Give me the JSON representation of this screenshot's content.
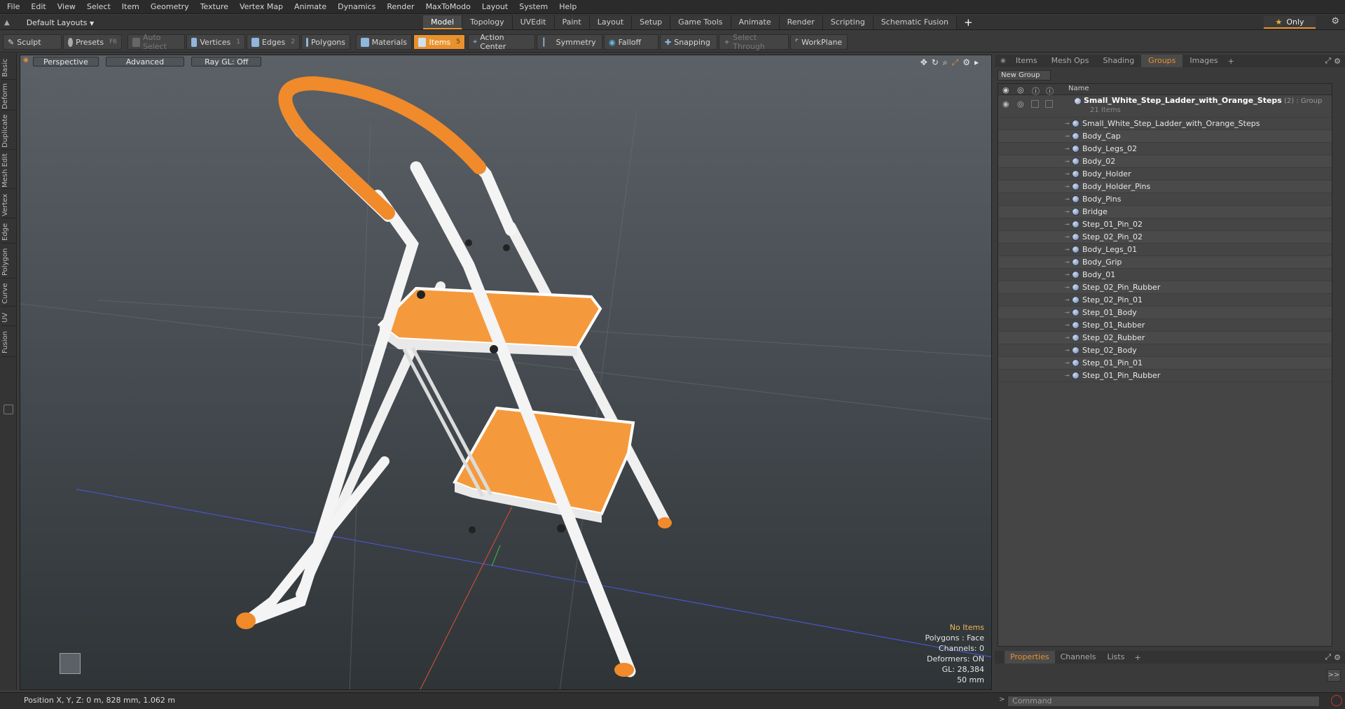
{
  "menu": [
    "File",
    "Edit",
    "View",
    "Select",
    "Item",
    "Geometry",
    "Texture",
    "Vertex Map",
    "Animate",
    "Dynamics",
    "Render",
    "MaxToModo",
    "Layout",
    "System",
    "Help"
  ],
  "layout_selector": "Default Layouts",
  "layout_tabs": [
    "Model",
    "Topology",
    "UVEdit",
    "Paint",
    "Layout",
    "Setup",
    "Game Tools",
    "Animate",
    "Render",
    "Scripting",
    "Schematic Fusion"
  ],
  "only_label": "Only",
  "toolbar": {
    "sculpt": "Sculpt",
    "presets": "Presets",
    "presets_key": "F6",
    "auto_select": "Auto Select",
    "vertices": "Vertices",
    "vertices_key": "1",
    "edges": "Edges",
    "edges_key": "2",
    "polygons": "Polygons",
    "materials": "Materials",
    "items": "Items",
    "items_key": "5",
    "action_center": "Action Center",
    "symmetry": "Symmetry",
    "falloff": "Falloff",
    "snapping": "Snapping",
    "select_through": "Select Through",
    "workplane": "WorkPlane"
  },
  "left_tabs": [
    "Basic",
    "Deform",
    "Duplicate",
    "Mesh Edit",
    "Vertex",
    "Edge",
    "Polygon",
    "Curve",
    "UV",
    "Fusion"
  ],
  "viewport": {
    "view_mode": "Perspective",
    "shading": "Advanced",
    "raygl": "Ray GL: Off"
  },
  "hud": {
    "selection": "No Items",
    "polygons": "Polygons : Face",
    "channels": "Channels: 0",
    "deformers": "Deformers: ON",
    "gl": "GL: 28,384",
    "grid": "50 mm"
  },
  "status": "Position X, Y, Z:  0 m, 828 mm, 1.062 m",
  "right_tabs": [
    "Items",
    "Mesh Ops",
    "Shading",
    "Groups",
    "Images"
  ],
  "new_group": "New Group",
  "list_header": "Name",
  "group": {
    "name": "Small_White_Step_Ladder_with_Orange_Steps",
    "meta": " (2) : Group",
    "count": "21 Items"
  },
  "items": [
    "Small_White_Step_Ladder_with_Orange_Steps",
    "Body_Cap",
    "Body_Legs_02",
    "Body_02",
    "Body_Holder",
    "Body_Holder_Pins",
    "Body_Pins",
    "Bridge",
    "Step_01_Pin_02",
    "Step_02_Pin_02",
    "Body_Legs_01",
    "Body_Grip",
    "Body_01",
    "Step_02_Pin_Rubber",
    "Step_02_Pin_01",
    "Step_01_Body",
    "Step_01_Rubber",
    "Step_02_Rubber",
    "Step_02_Body",
    "Step_01_Pin_01",
    "Step_01_Pin_Rubber"
  ],
  "bottom_tabs": [
    "Properties",
    "Channels",
    "Lists"
  ],
  "command_placeholder": "Command",
  "colors": {
    "accent": "#e8912d",
    "orange_step": "#f59a3c",
    "frame": "#f2f2f2"
  }
}
